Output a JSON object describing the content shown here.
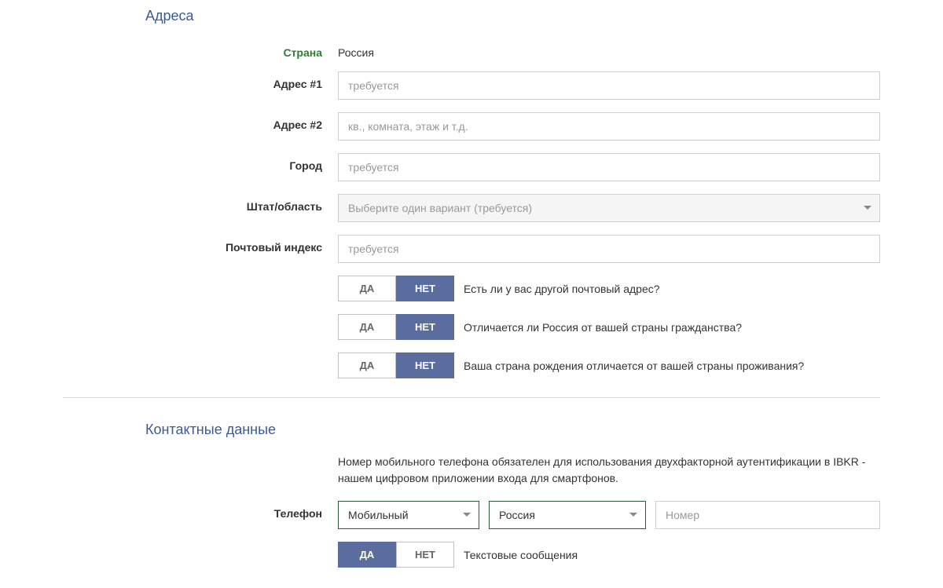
{
  "sections": {
    "address": {
      "title": "Адреса",
      "country_label": "Страна",
      "country_value": "Россия",
      "address1_label": "Адрес #1",
      "address1_placeholder": "требуется",
      "address2_label": "Адрес #2",
      "address2_placeholder": "кв., комната, этаж и т.д.",
      "city_label": "Город",
      "city_placeholder": "требуется",
      "state_label": "Штат/область",
      "state_placeholder": "Выберите один вариант (требуется)",
      "postal_label": "Почтовый индекс",
      "postal_placeholder": "требуется",
      "q1": {
        "yes": "ДА",
        "no": "НЕТ",
        "text": "Есть ли у вас другой почтовый адрес?"
      },
      "q2": {
        "yes": "ДА",
        "no": "НЕТ",
        "text": "Отличается ли Россия от вашей страны гражданства?"
      },
      "q3": {
        "yes": "ДА",
        "no": "НЕТ",
        "text": "Ваша страна рождения отличается от вашей страны проживания?"
      }
    },
    "contact": {
      "title": "Контактные данные",
      "note": "Номер мобильного телефона обязателен для использования двухфакторной аутентификации в IBKR - нашем цифровом приложении входа для смартфонов.",
      "phone_label": "Телефон",
      "phone_type": "Мобильный",
      "phone_country": "Россия",
      "phone_placeholder": "Номер",
      "sms": {
        "yes": "ДА",
        "no": "НЕТ",
        "text": "Текстовые сообщения"
      }
    }
  }
}
